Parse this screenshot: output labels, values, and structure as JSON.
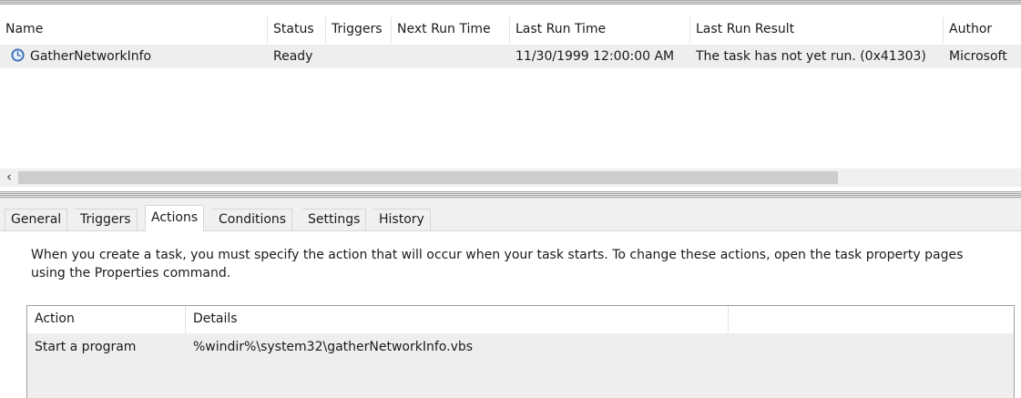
{
  "task_list": {
    "columns": [
      "Name",
      "Status",
      "Triggers",
      "Next Run Time",
      "Last Run Time",
      "Last Run Result",
      "Author"
    ],
    "rows": [
      {
        "icon": "clock-icon",
        "name": "GatherNetworkInfo",
        "status": "Ready",
        "triggers": "",
        "next_run_time": "",
        "last_run_time": "11/30/1999 12:00:00 AM",
        "last_run_result": "The task has not yet run. (0x41303)",
        "author": "Microsoft"
      }
    ],
    "scroll_left_glyph": "‹"
  },
  "tabs": [
    {
      "label": "General",
      "active": false
    },
    {
      "label": "Triggers",
      "active": false
    },
    {
      "label": "Actions",
      "active": true
    },
    {
      "label": "Conditions",
      "active": false
    },
    {
      "label": "Settings",
      "active": false
    },
    {
      "label": "History",
      "active": false
    }
  ],
  "actions_pane": {
    "description": "When you create a task, you must specify the action that will occur when your task starts.  To change these actions, open the task property pages using the Properties command.",
    "columns": [
      "Action",
      "Details"
    ],
    "rows": [
      {
        "action": "Start a program",
        "details": "%windir%\\system32\\gatherNetworkInfo.vbs"
      }
    ]
  },
  "colors": {
    "selected_row": "#eeeeee",
    "tab_strip": "#f0f0f0",
    "clock_icon": "#5b8fd6"
  }
}
